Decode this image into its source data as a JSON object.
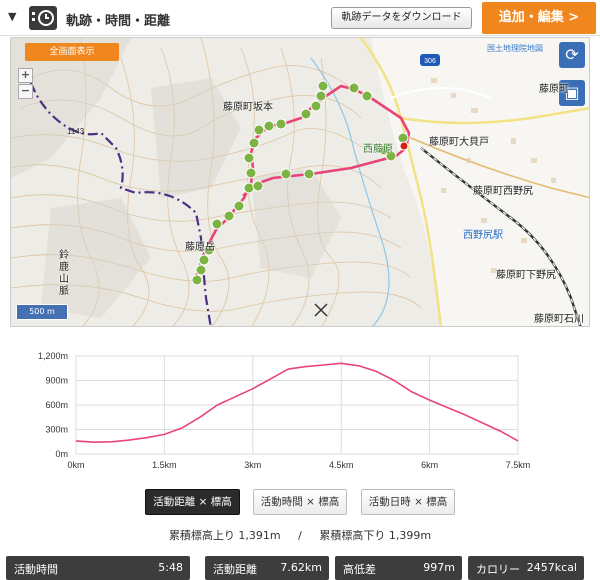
{
  "header": {
    "toggle": "▼",
    "title": "軌跡・時間・距離",
    "download_label": "軌跡データをダウンロード",
    "edit_label": "追加・編集 >"
  },
  "map": {
    "fullscreen_label": "全画面表示",
    "zoom_in": "+",
    "zoom_out": "−",
    "gsi_label": "国土地理院地図",
    "scale_label": "500 m",
    "route_sign": "306",
    "labels": {
      "sakamoto": "藤原町坂本",
      "nishifujiwara": "西藤原",
      "ookaido": "藤原町大貝戸",
      "nishinojiri": "藤原町西野尻",
      "station": "西野尻駅",
      "fujiwara_town": "藤原町",
      "shimonojiri": "藤原町下野尻",
      "ishikawa": "藤原町石川",
      "fujiwaradake": "藤原岳",
      "suzuka": "鈴鹿山脈",
      "peak": "1143"
    },
    "accent": "#f0861e",
    "track_color": "#e8447a"
  },
  "chart_data": {
    "type": "area",
    "x_label": "",
    "y_label": "",
    "x_ticks": [
      "0km",
      "1.5km",
      "3km",
      "4.5km",
      "6km",
      "7.5km"
    ],
    "y_ticks": [
      "0m",
      "300m",
      "600m",
      "900m",
      "1,200m"
    ],
    "xlim": [
      0,
      7.62
    ],
    "ylim": [
      0,
      1200
    ],
    "x": [
      0,
      0.3,
      0.6,
      0.9,
      1.2,
      1.5,
      1.8,
      2.1,
      2.4,
      2.7,
      3.0,
      3.3,
      3.6,
      3.9,
      4.2,
      4.5,
      4.8,
      5.1,
      5.4,
      5.7,
      6.0,
      6.3,
      6.6,
      6.9,
      7.2,
      7.62
    ],
    "y": [
      160,
      145,
      150,
      170,
      200,
      240,
      320,
      450,
      600,
      700,
      800,
      920,
      1040,
      1070,
      1090,
      1110,
      1080,
      1010,
      900,
      760,
      660,
      570,
      480,
      380,
      280,
      160
    ],
    "line_color": "#e8447a"
  },
  "tabs": [
    {
      "label": "活動距離 × 標高",
      "active": true
    },
    {
      "label": "活動時間 × 標高",
      "active": false
    },
    {
      "label": "活動日時 × 標高",
      "active": false
    }
  ],
  "elevation_gain": {
    "up": "累積標高上り 1,391m",
    "sep": "/",
    "down": "累積標高下り 1,399m"
  },
  "stats": [
    {
      "label": "活動時間",
      "value": "5:48"
    },
    {
      "label": "活動距離",
      "value": "7.62km"
    },
    {
      "label": "高低差",
      "value": "997m"
    },
    {
      "label": "カロリー",
      "value": "2457kcal"
    }
  ]
}
